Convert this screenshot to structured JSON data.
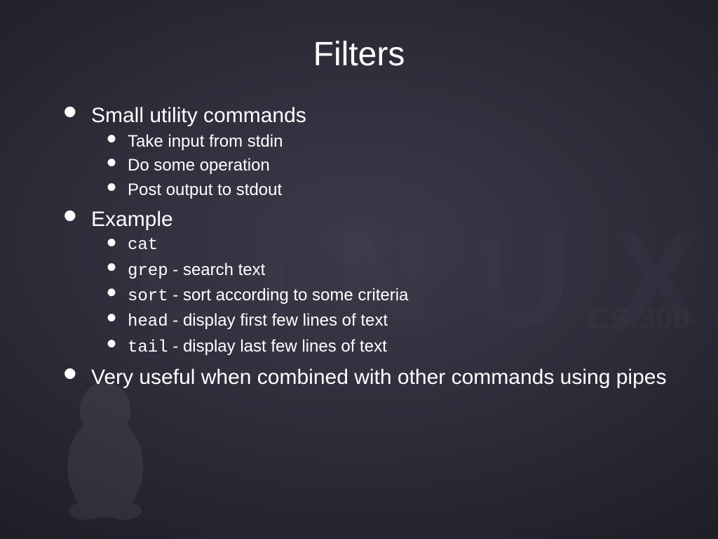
{
  "title": "Filters",
  "watermark": {
    "linux": "LINUX",
    "course": "CS 300"
  },
  "bullets": {
    "b1": {
      "text": "Small utility commands",
      "sub": {
        "s1": "Take input from stdin",
        "s2": "Do some operation",
        "s3": "Post output to stdout"
      }
    },
    "b2": {
      "text": "Example",
      "sub": {
        "s1": {
          "cmd": "cat",
          "desc": ""
        },
        "s2": {
          "cmd": "grep",
          "desc": "search text"
        },
        "s3": {
          "cmd": "sort",
          "desc": "sort according to some criteria"
        },
        "s4": {
          "cmd": "head",
          "desc": "display first few lines of text"
        },
        "s5": {
          "cmd": "tail",
          "desc": "display last few lines of text"
        }
      }
    },
    "b3": {
      "text": "Very useful when combined with other commands using pipes"
    }
  }
}
